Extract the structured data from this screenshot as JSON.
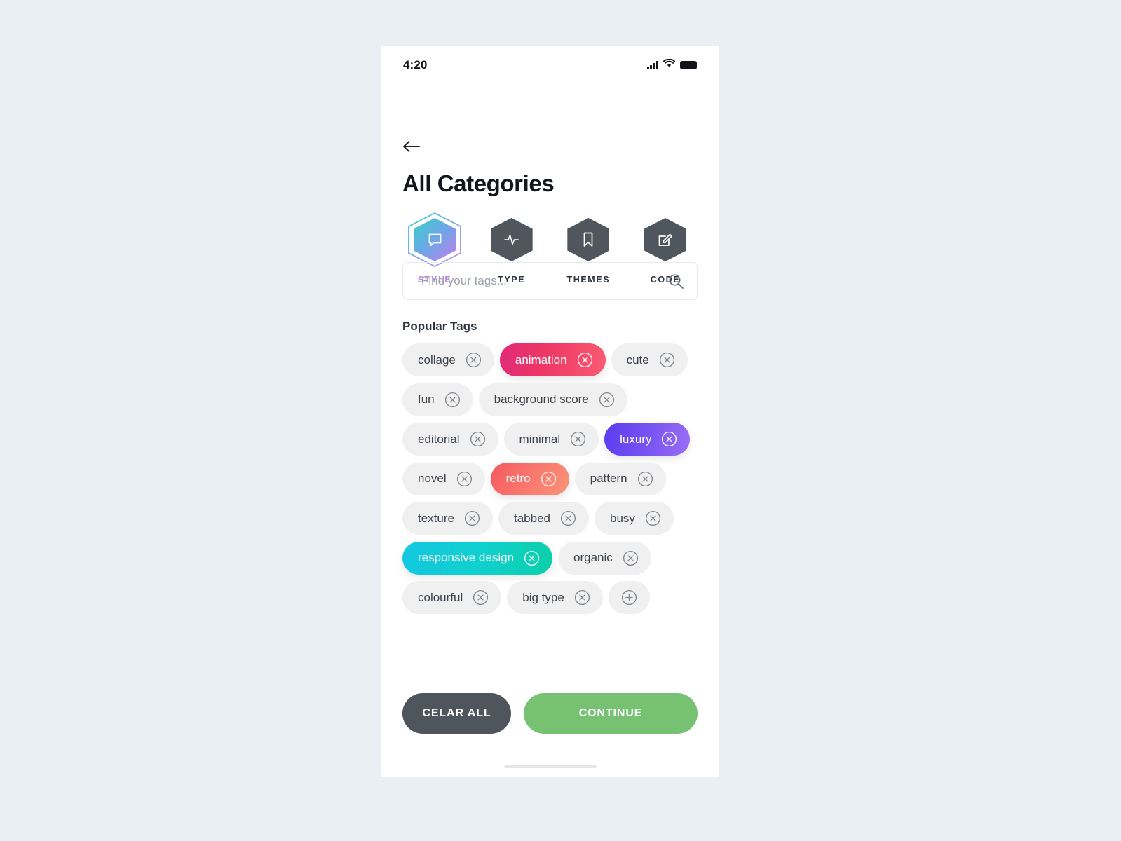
{
  "status_bar": {
    "time": "4:20",
    "signal_icon": "signal-bars-icon",
    "wifi_icon": "wifi-icon",
    "battery_icon": "battery-icon"
  },
  "header": {
    "back_icon": "back-arrow-icon",
    "title": "All Categories"
  },
  "categories": [
    {
      "label": "STYLE",
      "icon": "chat-bubble-icon",
      "active": true
    },
    {
      "label": "TYPE",
      "icon": "activity-pulse-icon",
      "active": false
    },
    {
      "label": "THEMES",
      "icon": "bookmark-icon",
      "active": false
    },
    {
      "label": "CODE",
      "icon": "edit-square-icon",
      "active": false
    }
  ],
  "search": {
    "placeholder": "Find your tags...",
    "value": "",
    "icon": "search-icon"
  },
  "tags_section": {
    "title": "Popular Tags",
    "remove_icon": "close-circle-icon",
    "add_icon": "plus-circle-icon",
    "rows": [
      [
        {
          "label": "collage",
          "selected": false
        },
        {
          "label": "animation",
          "selected": true,
          "gradient": "g-pink"
        },
        {
          "label": "cute",
          "selected": false
        }
      ],
      [
        {
          "label": "fun",
          "selected": false
        },
        {
          "label": "background score",
          "selected": false
        }
      ],
      [
        {
          "label": "editorial",
          "selected": false
        },
        {
          "label": "minimal",
          "selected": false
        },
        {
          "label": "luxury",
          "selected": true,
          "gradient": "g-purple"
        }
      ],
      [
        {
          "label": "novel",
          "selected": false
        },
        {
          "label": "retro",
          "selected": true,
          "gradient": "g-red"
        },
        {
          "label": "pattern",
          "selected": false
        }
      ],
      [
        {
          "label": "texture",
          "selected": false
        },
        {
          "label": "tabbed",
          "selected": false
        },
        {
          "label": "busy",
          "selected": false
        }
      ],
      [
        {
          "label": "responsive design",
          "selected": true,
          "gradient": "g-teal"
        },
        {
          "label": "organic",
          "selected": false
        }
      ],
      [
        {
          "label": "colourful",
          "selected": false
        },
        {
          "label": "big type",
          "selected": false
        },
        {
          "label": "",
          "selected": false,
          "add": true
        }
      ]
    ]
  },
  "footer": {
    "clear_label": "CELAR ALL",
    "continue_label": "CONTINUE"
  },
  "colors": {
    "page_background": "#eaeff4",
    "card_background": "#ffffff",
    "accent_purple": "#c08ae6",
    "hex_inactive": "#4f565e",
    "tag_idle": "#f0f0f1",
    "clear_button": "#4e555d",
    "continue_button": "#77c272"
  }
}
